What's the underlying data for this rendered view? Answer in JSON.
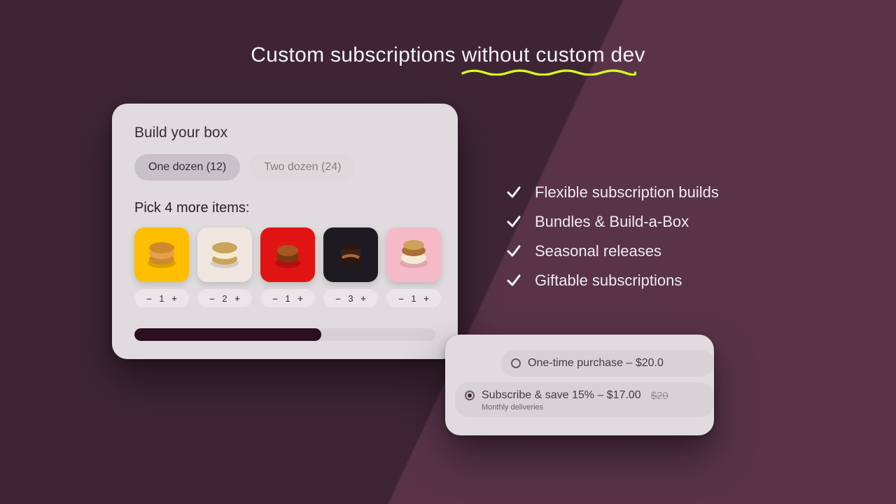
{
  "headline": {
    "pre": "Custom subscriptions ",
    "highlight": "without custom dev"
  },
  "features": [
    "Flexible subscription builds",
    "Bundles & Build-a-Box",
    "Seasonal releases",
    "Giftable subscriptions"
  ],
  "build": {
    "title": "Build your box",
    "sizes": [
      {
        "label": "One dozen (12)",
        "active": true
      },
      {
        "label": "Two dozen (24)",
        "active": false
      }
    ],
    "pick_label": "Pick 4 more items:",
    "products": [
      {
        "bg": "#ffbe00",
        "accent": "#c07a1f",
        "qty": "1"
      },
      {
        "bg": "#efe7df",
        "accent": "#c9a45a",
        "qty": "2"
      },
      {
        "bg": "#e11414",
        "accent": "#7a3a10",
        "qty": "1"
      },
      {
        "bg": "#1d1a21",
        "accent": "#b06a3a",
        "qty": "3"
      },
      {
        "bg": "#f6b9c7",
        "accent": "#a97038",
        "qty": "1"
      }
    ],
    "progress_pct": 62
  },
  "options": {
    "one_time": "One-time purchase – $20.0",
    "subscribe": "Subscribe & save 15% – $17.00",
    "strike": "$20",
    "note": "Monthly deliveries"
  }
}
